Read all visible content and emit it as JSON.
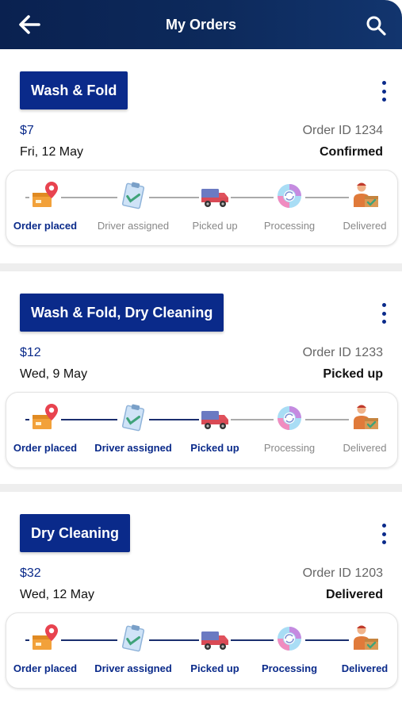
{
  "header": {
    "title": "My Orders",
    "back_icon": "arrow-left-icon",
    "search_icon": "search-icon"
  },
  "colors": {
    "header_bg": "#0d2a5c",
    "accent": "#0a2a8a",
    "inactive": "#888888",
    "line_active": "#1a2e6e",
    "line_inactive": "#aaaaaa"
  },
  "steps": [
    "Order placed",
    "Driver assigned",
    "Picked up",
    "Processing",
    "Delivered"
  ],
  "step_icons": [
    "location-box-icon",
    "clipboard-check-icon",
    "delivery-truck-icon",
    "washing-cycle-icon",
    "delivery-person-icon"
  ],
  "orders": [
    {
      "service": "Wash & Fold",
      "price": "$7",
      "order_id": "Order ID 1234",
      "date": "Fri, 12 May",
      "status": "Confirmed",
      "completed_steps": 1
    },
    {
      "service": "Wash & Fold, Dry Cleaning",
      "price": "$12",
      "order_id": "Order ID 1233",
      "date": "Wed, 9 May",
      "status": "Picked up",
      "completed_steps": 3
    },
    {
      "service": "Dry Cleaning",
      "price": "$32",
      "order_id": "Order ID 1203",
      "date": "Wed, 12 May",
      "status": "Delivered",
      "completed_steps": 5
    }
  ]
}
